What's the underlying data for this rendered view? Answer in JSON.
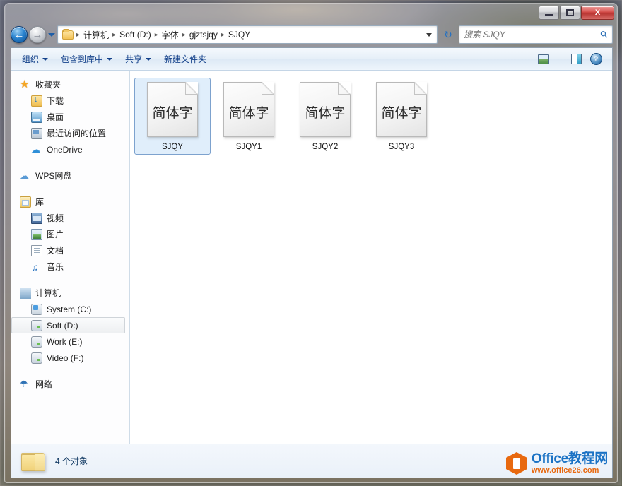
{
  "window": {
    "buttons": {
      "minimize": "minimize-button",
      "maximize": "maximize-button",
      "close_label": "X"
    }
  },
  "navigation": {
    "back_label": "←",
    "forward_label": "→",
    "refresh_label": "↻",
    "breadcrumb": [
      "计算机",
      "Soft (D:)",
      "字体",
      "gjztsjqy",
      "SJQY"
    ],
    "separator": "▸"
  },
  "search": {
    "placeholder": "搜索 SJQY",
    "value": "",
    "icon": "search-icon"
  },
  "commandbar": {
    "items": [
      {
        "label": "组织",
        "has_menu": true
      },
      {
        "label": "包含到库中",
        "has_menu": true
      },
      {
        "label": "共享",
        "has_menu": true
      },
      {
        "label": "新建文件夹",
        "has_menu": false
      }
    ],
    "right_icons": [
      "view-options-icon",
      "preview-pane-icon",
      "help-icon"
    ],
    "help_glyph": "?"
  },
  "sidebar": {
    "sections": [
      {
        "header": {
          "label": "收藏夹",
          "icon": "star-icon"
        },
        "items": [
          {
            "label": "下载",
            "icon": "downloads-icon"
          },
          {
            "label": "桌面",
            "icon": "desktop-icon"
          },
          {
            "label": "最近访问的位置",
            "icon": "recent-places-icon"
          },
          {
            "label": "OneDrive",
            "icon": "onedrive-icon"
          }
        ]
      },
      {
        "header": {
          "label": "WPS网盘",
          "icon": "wps-cloud-icon"
        },
        "items": []
      },
      {
        "header": {
          "label": "库",
          "icon": "library-icon"
        },
        "items": [
          {
            "label": "视频",
            "icon": "video-icon"
          },
          {
            "label": "图片",
            "icon": "picture-icon"
          },
          {
            "label": "文档",
            "icon": "document-icon"
          },
          {
            "label": "音乐",
            "icon": "music-icon"
          }
        ]
      },
      {
        "header": {
          "label": "计算机",
          "icon": "computer-icon"
        },
        "items": [
          {
            "label": "System (C:)",
            "icon": "system-drive-icon",
            "selected": false
          },
          {
            "label": "Soft (D:)",
            "icon": "drive-icon",
            "selected": true
          },
          {
            "label": "Work (E:)",
            "icon": "drive-icon",
            "selected": false
          },
          {
            "label": "Video (F:)",
            "icon": "drive-icon",
            "selected": false
          }
        ]
      },
      {
        "header": {
          "label": "网络",
          "icon": "network-icon"
        },
        "items": []
      }
    ]
  },
  "content": {
    "files": [
      {
        "name": "SJQY",
        "preview": "简体字",
        "selected": true
      },
      {
        "name": "SJQY1",
        "preview": "简体字",
        "selected": false
      },
      {
        "name": "SJQY2",
        "preview": "简体字",
        "selected": false
      },
      {
        "name": "SJQY3",
        "preview": "简体字",
        "selected": false
      }
    ]
  },
  "statusbar": {
    "item_count_text": "4 个对象",
    "folder_icon": "folder-icon"
  },
  "watermark": {
    "brand": "Office教程网",
    "url": "www.office26.com",
    "accent_orange": "#e8690f",
    "accent_blue": "#1a72c4"
  }
}
